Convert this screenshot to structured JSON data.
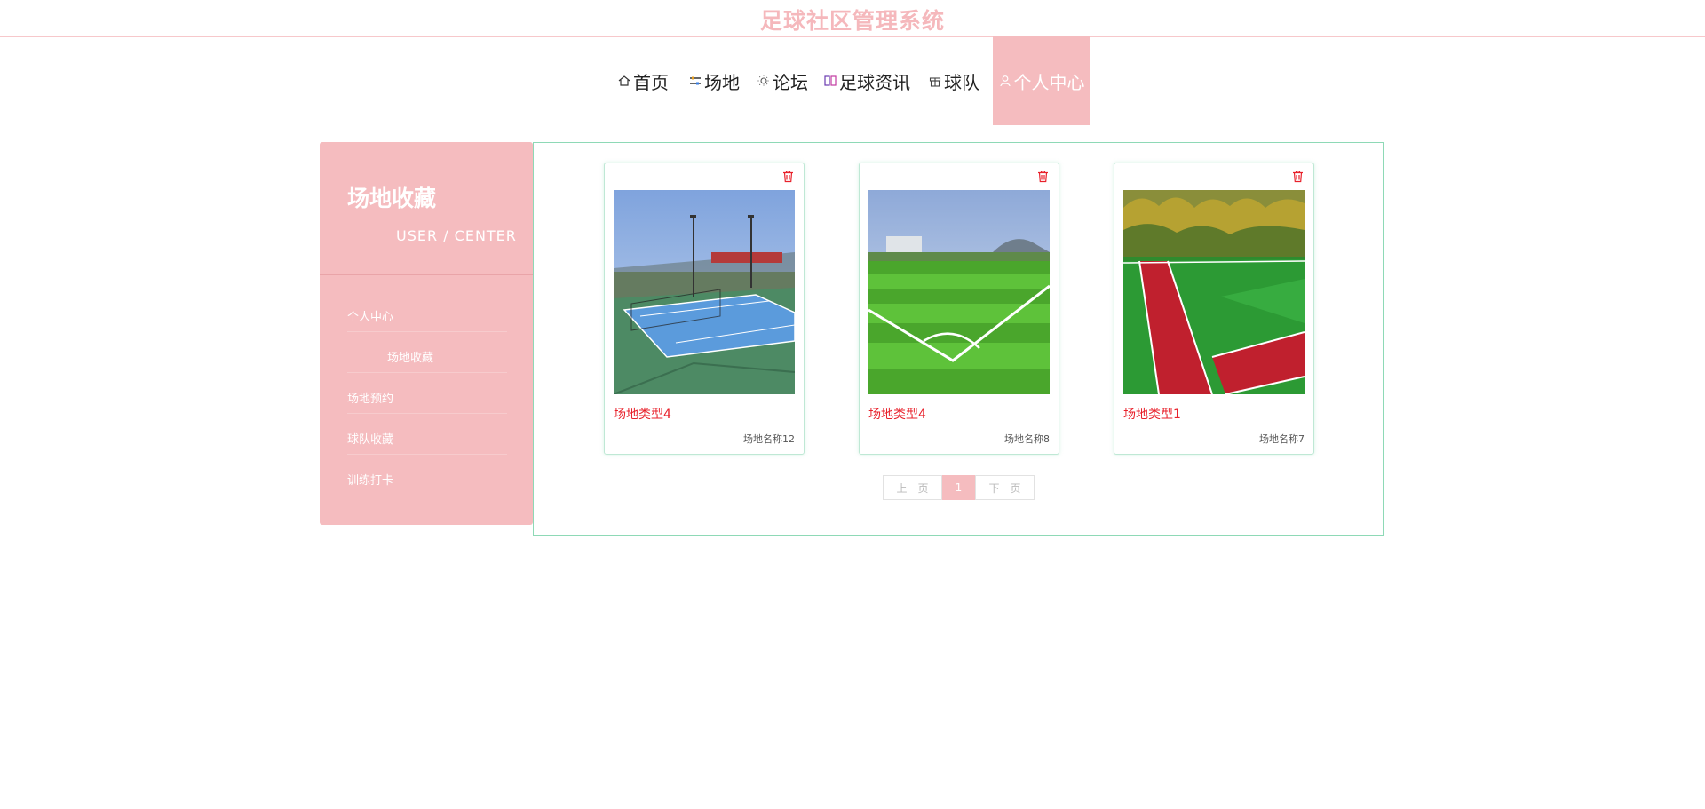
{
  "header": {
    "title": "足球社区管理系统"
  },
  "nav": {
    "items": [
      {
        "label": "首页",
        "icon": "home-icon"
      },
      {
        "label": "场地",
        "icon": "sliders-icon"
      },
      {
        "label": "论坛",
        "icon": "sun-icon"
      },
      {
        "label": "足球资讯",
        "icon": "book-icon"
      },
      {
        "label": "球队",
        "icon": "gift-icon"
      },
      {
        "label": "个人中心",
        "icon": "user-icon",
        "active": true
      }
    ]
  },
  "sidebar": {
    "title": "场地收藏",
    "subtitle": "USER / CENTER",
    "items": [
      {
        "label": "个人中心"
      },
      {
        "label": "场地收藏",
        "active": true
      },
      {
        "label": "场地预约"
      },
      {
        "label": "球队收藏"
      },
      {
        "label": "训练打卡"
      }
    ]
  },
  "cards": [
    {
      "type": "场地类型4",
      "name": "场地名称12",
      "image": "tennis-court-photo"
    },
    {
      "type": "场地类型4",
      "name": "场地名称8",
      "image": "football-pitch-photo"
    },
    {
      "type": "场地类型1",
      "name": "场地名称7",
      "image": "running-track-photo"
    }
  ],
  "pagination": {
    "prev": "上一页",
    "current": "1",
    "next": "下一页"
  },
  "colors": {
    "accent": "#f5bcbf",
    "border_green": "#8ed9b6",
    "type_red": "#e8212b"
  }
}
